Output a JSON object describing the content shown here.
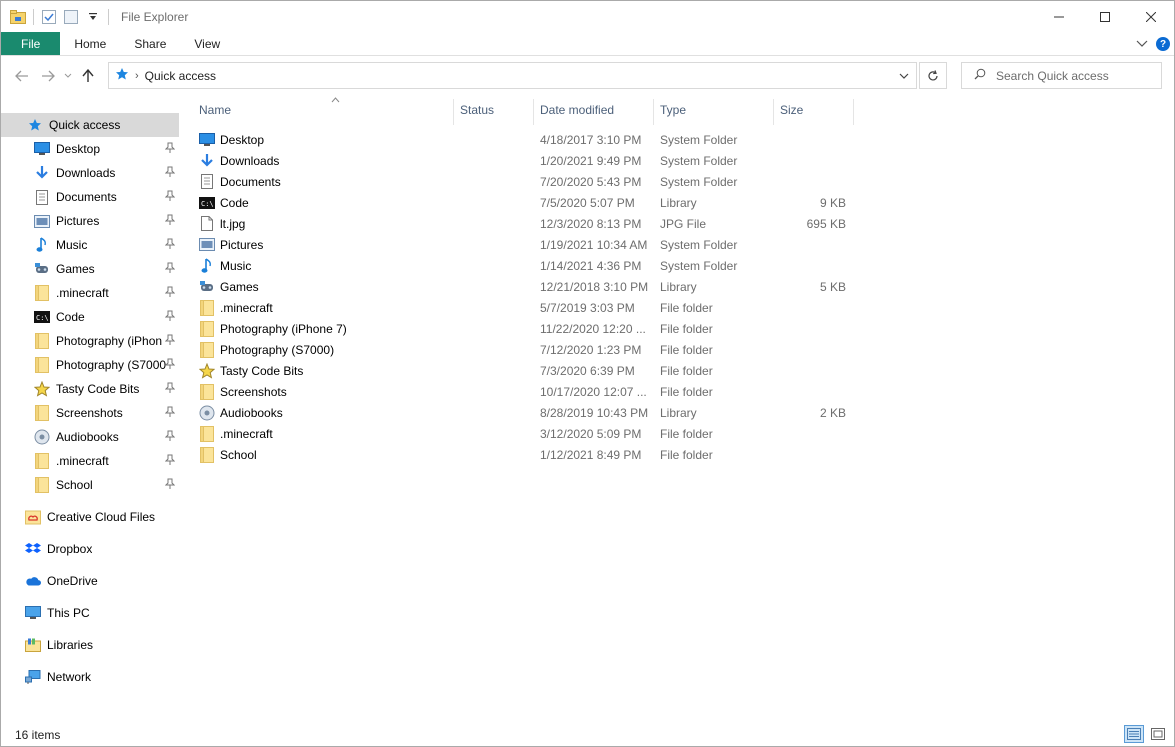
{
  "window": {
    "title": "File Explorer"
  },
  "ribbon": {
    "tabs": [
      "File",
      "Home",
      "Share",
      "View"
    ],
    "help": "?"
  },
  "address": {
    "path": "Quick access"
  },
  "search": {
    "placeholder": "Search Quick access"
  },
  "columns": {
    "name": "Name",
    "status": "Status",
    "date": "Date modified",
    "type": "Type",
    "size": "Size"
  },
  "sidebar": {
    "quick_access": "Quick access",
    "pinned": [
      {
        "label": "Desktop",
        "icon": "desktop-icon"
      },
      {
        "label": "Downloads",
        "icon": "download-icon"
      },
      {
        "label": "Documents",
        "icon": "document-icon"
      },
      {
        "label": "Pictures",
        "icon": "picture-icon"
      },
      {
        "label": "Music",
        "icon": "music-icon"
      },
      {
        "label": "Games",
        "icon": "games-icon"
      },
      {
        "label": ".minecraft",
        "icon": "folder-icon"
      },
      {
        "label": "Code",
        "icon": "code-icon"
      },
      {
        "label": "Photography (iPhon",
        "icon": "folder-icon"
      },
      {
        "label": "Photography (S7000",
        "icon": "folder-icon"
      },
      {
        "label": "Tasty Code Bits",
        "icon": "star-icon"
      },
      {
        "label": "Screenshots",
        "icon": "folder-icon"
      },
      {
        "label": "Audiobooks",
        "icon": "audiobook-icon"
      },
      {
        "label": ".minecraft",
        "icon": "folder-icon"
      },
      {
        "label": "School",
        "icon": "folder-icon"
      }
    ],
    "roots": [
      {
        "label": "Creative Cloud Files",
        "icon": "creative-cloud-icon"
      },
      {
        "label": "Dropbox",
        "icon": "dropbox-icon"
      },
      {
        "label": "OneDrive",
        "icon": "onedrive-icon"
      },
      {
        "label": "This PC",
        "icon": "computer-icon"
      },
      {
        "label": "Libraries",
        "icon": "library-icon"
      },
      {
        "label": "Network",
        "icon": "network-icon"
      }
    ]
  },
  "files": [
    {
      "name": "Desktop",
      "date": "4/18/2017 3:10 PM",
      "type": "System Folder",
      "size": "",
      "icon": "desktop-icon"
    },
    {
      "name": "Downloads",
      "date": "1/20/2021 9:49 PM",
      "type": "System Folder",
      "size": "",
      "icon": "download-icon"
    },
    {
      "name": "Documents",
      "date": "7/20/2020 5:43 PM",
      "type": "System Folder",
      "size": "",
      "icon": "document-icon"
    },
    {
      "name": "Code",
      "date": "7/5/2020 5:07 PM",
      "type": "Library",
      "size": "9 KB",
      "icon": "code-icon"
    },
    {
      "name": "lt.jpg",
      "date": "12/3/2020 8:13 PM",
      "type": "JPG File",
      "size": "695 KB",
      "icon": "image-file-icon"
    },
    {
      "name": "Pictures",
      "date": "1/19/2021 10:34 AM",
      "type": "System Folder",
      "size": "",
      "icon": "picture-icon"
    },
    {
      "name": "Music",
      "date": "1/14/2021 4:36 PM",
      "type": "System Folder",
      "size": "",
      "icon": "music-icon"
    },
    {
      "name": "Games",
      "date": "12/21/2018 3:10 PM",
      "type": "Library",
      "size": "5 KB",
      "icon": "games-icon"
    },
    {
      "name": ".minecraft",
      "date": "5/7/2019 3:03 PM",
      "type": "File folder",
      "size": "",
      "icon": "folder-icon"
    },
    {
      "name": "Photography (iPhone 7)",
      "date": "11/22/2020 12:20 ...",
      "type": "File folder",
      "size": "",
      "icon": "folder-icon"
    },
    {
      "name": "Photography (S7000)",
      "date": "7/12/2020 1:23 PM",
      "type": "File folder",
      "size": "",
      "icon": "folder-icon"
    },
    {
      "name": "Tasty Code Bits",
      "date": "7/3/2020 6:39 PM",
      "type": "File folder",
      "size": "",
      "icon": "star-icon"
    },
    {
      "name": "Screenshots",
      "date": "10/17/2020 12:07 ...",
      "type": "File folder",
      "size": "",
      "icon": "folder-icon"
    },
    {
      "name": "Audiobooks",
      "date": "8/28/2019 10:43 PM",
      "type": "Library",
      "size": "2 KB",
      "icon": "audiobook-icon"
    },
    {
      "name": ".minecraft",
      "date": "3/12/2020 5:09 PM",
      "type": "File folder",
      "size": "",
      "icon": "folder-icon"
    },
    {
      "name": "School",
      "date": "1/12/2021 8:49 PM",
      "type": "File folder",
      "size": "",
      "icon": "folder-icon"
    }
  ],
  "status": {
    "count": "16 items"
  }
}
